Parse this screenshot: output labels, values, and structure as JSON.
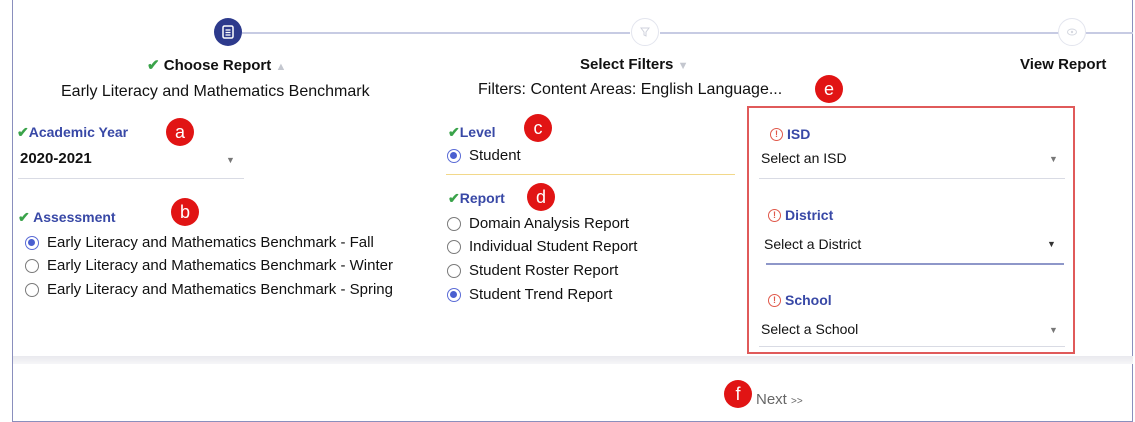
{
  "stepper": {
    "steps": [
      {
        "title": "Choose Report",
        "subtitle": "Early Literacy and Mathematics Benchmark"
      },
      {
        "title": "Select Filters",
        "subtitle": "Filters: Content Areas: English Language..."
      },
      {
        "title": "View Report"
      }
    ]
  },
  "form": {
    "academic_year": {
      "label": "Academic Year",
      "value": "2020-2021"
    },
    "assessment": {
      "label": "Assessment",
      "options": [
        {
          "label": "Early Literacy and Mathematics Benchmark - Fall",
          "selected": true
        },
        {
          "label": "Early Literacy and Mathematics Benchmark - Winter",
          "selected": false
        },
        {
          "label": "Early Literacy and Mathematics Benchmark - Spring",
          "selected": false
        }
      ]
    },
    "level": {
      "label": "Level",
      "options": [
        {
          "label": "Student",
          "selected": true
        }
      ]
    },
    "report": {
      "label": "Report",
      "options": [
        {
          "label": "Domain Analysis Report",
          "selected": false
        },
        {
          "label": "Individual Student Report",
          "selected": false
        },
        {
          "label": "Student Roster Report",
          "selected": false
        },
        {
          "label": "Student Trend Report",
          "selected": true
        }
      ]
    },
    "isd": {
      "label": "ISD",
      "placeholder": "Select an ISD"
    },
    "district": {
      "label": "District",
      "placeholder": "Select a District"
    },
    "school": {
      "label": "School",
      "placeholder": "Select a School"
    }
  },
  "callouts": {
    "a": "a",
    "b": "b",
    "c": "c",
    "d": "d",
    "e": "e",
    "f": "f"
  },
  "footer": {
    "next_label": "Next",
    "next_chevron": ">>"
  },
  "colors": {
    "accent": "#2d3a8c",
    "label": "#3848a6",
    "check": "#3aa34a",
    "callout": "#e11414",
    "required_border": "#e05a5a"
  }
}
